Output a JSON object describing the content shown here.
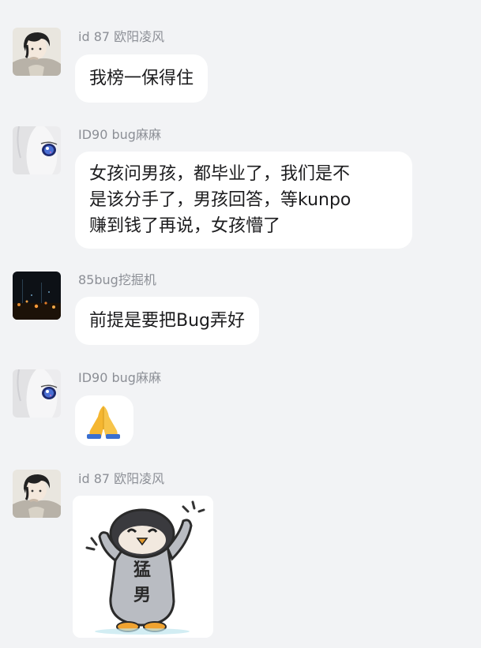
{
  "messages": [
    {
      "sender": "id 87 欧阳凌风",
      "avatar": "anime-boy-avatar",
      "text": "我榜一保得住"
    },
    {
      "sender": "ID90 bug麻麻",
      "avatar": "anime-girl-avatar",
      "text": "女孩问男孩，都毕业了，我们是不\n是该分手了，男孩回答，等kunpo\n赚到钱了再说，女孩懵了"
    },
    {
      "sender": "85bug挖掘机",
      "avatar": "night-city-avatar",
      "text": "前提是要把Bug弄好"
    },
    {
      "sender": "ID90 bug麻麻",
      "avatar": "anime-girl-avatar",
      "emoji": "folded-hands-emoji"
    },
    {
      "sender": "id 87 欧阳凌风",
      "avatar": "anime-boy-avatar",
      "sticker": {
        "name": "penguin-sticker",
        "text_line1": "猛",
        "text_line2": "男"
      }
    }
  ],
  "colors": {
    "background": "#f2f3f5",
    "bubble": "#ffffff",
    "sender_text": "#8c8f96",
    "message_text": "#1c1c1e"
  }
}
